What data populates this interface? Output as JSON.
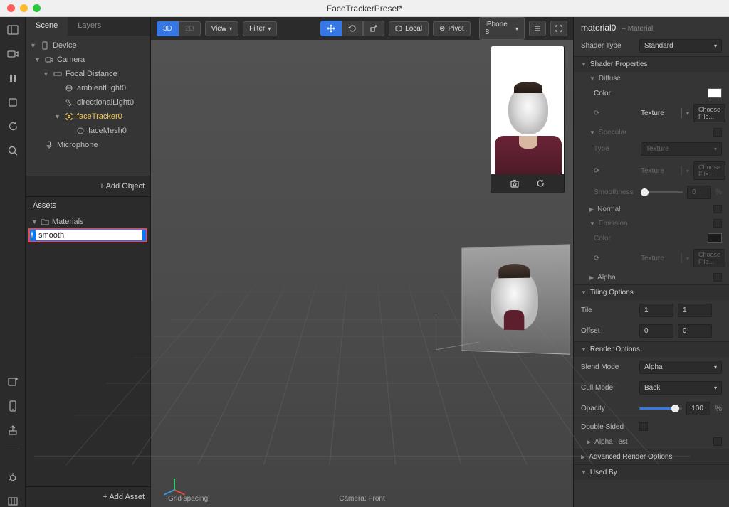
{
  "window": {
    "title": "FaceTrackerPreset*"
  },
  "scene_tabs": {
    "scene": "Scene",
    "layers": "Layers"
  },
  "scene_tree": {
    "device": "Device",
    "camera": "Camera",
    "focal": "Focal Distance",
    "ambient": "ambientLight0",
    "directional": "directionalLight0",
    "facetracker": "faceTracker0",
    "facemesh": "faceMesh0",
    "microphone": "Microphone"
  },
  "add_object": "+  Add Object",
  "assets": {
    "title": "Assets",
    "materials_folder": "Materials",
    "item_name": "smooth",
    "add_asset": "+  Add Asset"
  },
  "viewport": {
    "mode3d": "3D",
    "mode2d": "2D",
    "view": "View",
    "filter": "Filter",
    "local": "Local",
    "pivot": "Pivot",
    "device": "iPhone 8",
    "camera_label": "Camera: Front",
    "grid_label": "Grid spacing:"
  },
  "inspector": {
    "name": "material0",
    "subtitle": "– Material",
    "shader_type_lbl": "Shader Type",
    "shader_type_val": "Standard",
    "shader_props": "Shader Properties",
    "diffuse": "Diffuse",
    "color": "Color",
    "texture": "Texture",
    "choose": "Choose File...",
    "specular": "Specular",
    "type": "Type",
    "type_val": "Texture",
    "smoothness": "Smoothness",
    "smoothness_val": "0",
    "normal": "Normal",
    "emission": "Emission",
    "alpha": "Alpha",
    "tiling": "Tiling Options",
    "tile": "Tile",
    "tile_x": "1",
    "tile_y": "1",
    "offset": "Offset",
    "off_x": "0",
    "off_y": "0",
    "render": "Render Options",
    "blend_mode": "Blend Mode",
    "blend_val": "Alpha",
    "cull_mode": "Cull Mode",
    "cull_val": "Back",
    "opacity": "Opacity",
    "opacity_val": "100",
    "double_sided": "Double Sided",
    "alpha_test": "Alpha Test",
    "advanced": "Advanced Render Options",
    "used_by": "Used By"
  }
}
